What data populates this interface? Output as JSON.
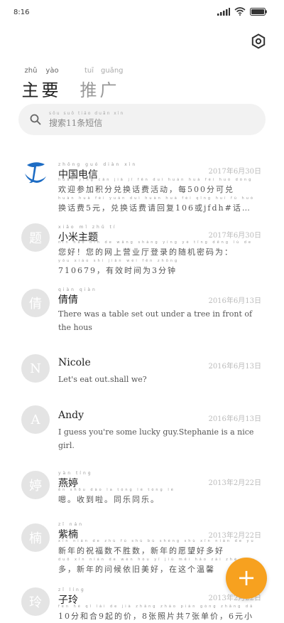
{
  "status": {
    "time": "8:16"
  },
  "header": {
    "tabs": [
      {
        "label": "主要",
        "pinyin": [
          "zhǔ",
          "yào"
        ]
      },
      {
        "label": "推广",
        "pinyin": [
          "tuī",
          "guǎng"
        ]
      }
    ]
  },
  "search": {
    "placeholder": "搜索11条短信",
    "pinyin": "sōu suǒ tiáo duǎn xìn"
  },
  "conversations": [
    {
      "name": "中国电信",
      "name_pinyin": "zhōng guó diàn xìn",
      "avatar": "",
      "date": "2017年6月30日",
      "pinyin1": "huān yíng cān jiā jī fēn duì huàn huà fèi huó dòng měi kě duì",
      "line1": "欢迎参加积分兑换话费活动，每500分可兑",
      "pinyin2": "huàn huà fèi yuán duì huàn huà fèi qǐng huí fù huò",
      "line2": "换话费5元，兑换话费请回复106或jfdh#话…"
    },
    {
      "name": "小米主题",
      "name_pinyin": "xiǎo mǐ zhǔ tí",
      "avatar": "题",
      "date": "2017年6月30日",
      "pinyin1": "nín hǎo nín de wǎng shàng yíng yè tīng dēng lù de suí jī mì mǎ wéi",
      "line1": "您好！您的网上营业厅登录的随机密码为：",
      "pinyin2": "yǒu xiào shí jiān wéi fēn zhōng",
      "line2": "710679，有效时间为3分钟"
    },
    {
      "name": "倩倩",
      "name_pinyin": "qiàn qiàn",
      "avatar": "倩",
      "date": "2016年6月13日",
      "line1": "There was a table set out under a tree in front of",
      "line2": "the hous"
    },
    {
      "name": "Nicole",
      "name_pinyin": "",
      "avatar": "N",
      "date": "2016年6月13日",
      "line1": "Let's eat out.shall we?",
      "line2": ""
    },
    {
      "name": "Andy",
      "name_pinyin": "",
      "avatar": "A",
      "date": "2016年6月13日",
      "line1": "I guess you're some lucky guy.Stephanie is a nice",
      "line2": "girl."
    },
    {
      "name": "燕婷",
      "name_pinyin": "yàn tíng",
      "avatar": "婷",
      "date": "2013年2月22日",
      "pinyin1": "ēn shōu dào la tóng lè tóng lè",
      "line1": "嗯。收到啦。同乐同乐。",
      "pinyin2": "",
      "line2": ""
    },
    {
      "name": "紫楠",
      "name_pinyin": "zǐ nán",
      "avatar": "楠",
      "date": "2013年2月22日",
      "pinyin1": "xīn nián de zhù fú shù bù shèng shù xīn nián de yuàn wàng hǎo duō hǎo",
      "line1": "新年的祝福数不胜数，新年的愿望好多好",
      "pinyin2": "duō xīn nián de wèn hòu yī jiù měi hǎo zài zhè ge wēn xīn",
      "line2": "多，新年的问候依旧美好，在这个温馨"
    },
    {
      "name": "子玲",
      "name_pinyin": "zǐ líng",
      "avatar": "玲",
      "date": "2013年2月22日",
      "pinyin1": "fèn hé qǐ lái de jià zhāng zhào piàn gòng zhāng dān jià yuán xiǎo",
      "line1": "10分和合9起的价，8张照片共7张单价，6元小",
      "pinyin2": "",
      "line2": ""
    }
  ],
  "fab": {
    "label": "+"
  },
  "colors": {
    "accent": "#f7a11f",
    "avatar_bg": "#e4e4e4",
    "search_bg": "#f2f2f2",
    "telecom_blue": "#1d6cc4"
  }
}
